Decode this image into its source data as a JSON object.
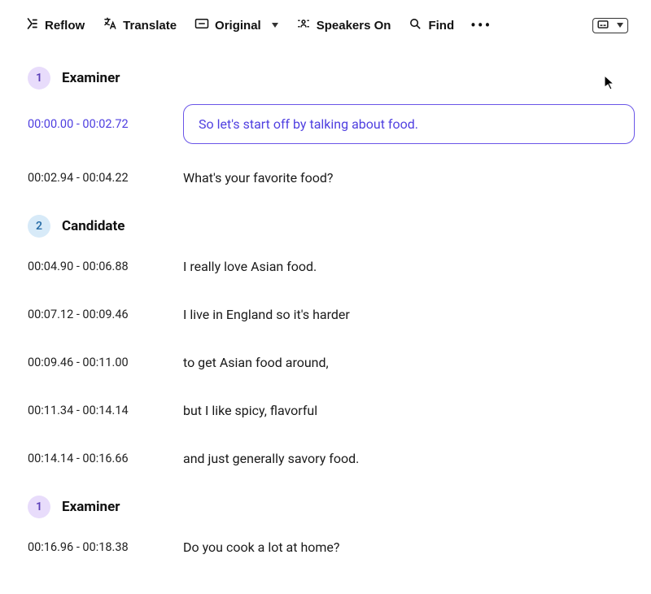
{
  "toolbar": {
    "reflow": "Reflow",
    "translate": "Translate",
    "original": "Original",
    "speakers": "Speakers On",
    "find": "Find"
  },
  "transcript": {
    "blocks": [
      {
        "speaker_idx": "1",
        "speaker_name": "Examiner",
        "speaker_style": "purple",
        "lines": [
          {
            "start": "00:00.00",
            "end": "00:02.72",
            "text": "So let's start off by talking about food.",
            "highlight": true
          },
          {
            "start": "00:02.94",
            "end": "00:04.22",
            "text": "What's your favorite food?",
            "highlight": false
          }
        ]
      },
      {
        "speaker_idx": "2",
        "speaker_name": "Candidate",
        "speaker_style": "blue",
        "lines": [
          {
            "start": "00:04.90",
            "end": "00:06.88",
            "text": "I really love Asian food.",
            "highlight": false
          },
          {
            "start": "00:07.12",
            "end": "00:09.46",
            "text": "I live in England so it's harder",
            "highlight": false
          },
          {
            "start": "00:09.46",
            "end": "00:11.00",
            "text": "to get Asian food around,",
            "highlight": false
          },
          {
            "start": "00:11.34",
            "end": "00:14.14",
            "text": "but I like spicy, flavorful",
            "highlight": false
          },
          {
            "start": "00:14.14",
            "end": "00:16.66",
            "text": "and just generally savory food.",
            "highlight": false
          }
        ]
      },
      {
        "speaker_idx": "1",
        "speaker_name": "Examiner",
        "speaker_style": "purple",
        "lines": [
          {
            "start": "00:16.96",
            "end": "00:18.38",
            "text": "Do you cook a lot at home?",
            "highlight": false
          }
        ]
      }
    ]
  }
}
